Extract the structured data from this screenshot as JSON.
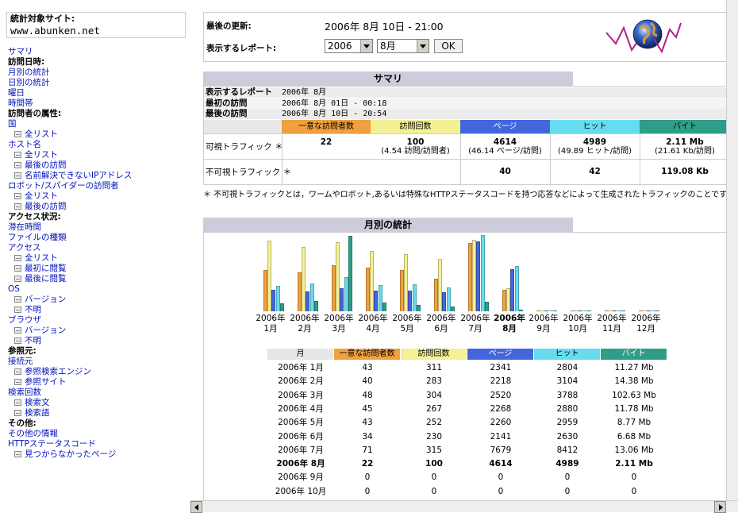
{
  "colors": {
    "unique": "#f0a040",
    "visits": "#f4f094",
    "pages": "#4466dd",
    "hits": "#66ddee",
    "bytes": "#2e9e88",
    "link": "#0011bb",
    "header_bg": "#ccccdd"
  },
  "sidebar": {
    "site_label": "統計対象サイト:",
    "site_value": "www.abunken.net",
    "menu": [
      {
        "t": "サマリ",
        "k": "link"
      },
      {
        "t": "訪問日時:",
        "k": "head"
      },
      {
        "t": "月別の統計",
        "k": "link"
      },
      {
        "t": "日別の統計",
        "k": "link"
      },
      {
        "t": "曜日",
        "k": "link"
      },
      {
        "t": "時間帯",
        "k": "link"
      },
      {
        "t": "訪問者の属性:",
        "k": "head"
      },
      {
        "t": "国",
        "k": "link"
      },
      {
        "t": "全リスト",
        "k": "sub"
      },
      {
        "t": "ホスト名",
        "k": "link"
      },
      {
        "t": "全リスト",
        "k": "sub"
      },
      {
        "t": "最後の訪問",
        "k": "sub"
      },
      {
        "t": "名前解決できないIPアドレス",
        "k": "sub"
      },
      {
        "t": "ロボット/スパイダーの訪問者",
        "k": "link"
      },
      {
        "t": "全リスト",
        "k": "sub"
      },
      {
        "t": "最後の訪問",
        "k": "sub"
      },
      {
        "t": "アクセス状況:",
        "k": "head"
      },
      {
        "t": "滞在時間",
        "k": "link"
      },
      {
        "t": "ファイルの種類",
        "k": "link"
      },
      {
        "t": "アクセス",
        "k": "link"
      },
      {
        "t": "全リスト",
        "k": "sub"
      },
      {
        "t": "最初に閲覧",
        "k": "sub"
      },
      {
        "t": "最後に閲覧",
        "k": "sub"
      },
      {
        "t": "OS",
        "k": "link"
      },
      {
        "t": "バージョン",
        "k": "sub"
      },
      {
        "t": "不明",
        "k": "sub"
      },
      {
        "t": "ブラウザ",
        "k": "link"
      },
      {
        "t": "バージョン",
        "k": "sub"
      },
      {
        "t": "不明",
        "k": "sub"
      },
      {
        "t": "参照元:",
        "k": "head"
      },
      {
        "t": "接続元",
        "k": "link"
      },
      {
        "t": "参照検索エンジン",
        "k": "sub"
      },
      {
        "t": "参照サイト",
        "k": "sub"
      },
      {
        "t": "検索回数",
        "k": "link"
      },
      {
        "t": "検索文",
        "k": "sub"
      },
      {
        "t": "検索語",
        "k": "sub"
      },
      {
        "t": "その他:",
        "k": "head"
      },
      {
        "t": "その他の情報",
        "k": "link"
      },
      {
        "t": "HTTPステータスコード",
        "k": "link"
      },
      {
        "t": "見つからなかったページ",
        "k": "sub"
      }
    ]
  },
  "header": {
    "last_update_label": "最後の更新:",
    "last_update_value": "2006年 8月 10日 - 21:00",
    "report_label": "表示するレポート:",
    "year_select": "2006",
    "month_select": "8月",
    "ok_label": "OK"
  },
  "summary": {
    "title": "サマリ",
    "rows": [
      {
        "k": "表示するレポート",
        "v": "2006年 8月"
      },
      {
        "k": "最初の訪問",
        "v": "2006年 8月 01日 - 00:18"
      },
      {
        "k": "最後の訪問",
        "v": "2006年 8月 10日 - 20:54"
      }
    ],
    "cols": [
      "一意な訪問者数",
      "訪問回数",
      "ページ",
      "ヒット",
      "バイト"
    ],
    "visible_label": "可視トラフィック ＊",
    "visible": [
      {
        "a": "22",
        "b": ""
      },
      {
        "a": "100",
        "b": "(4.54 訪問/訪問者)"
      },
      {
        "a": "4614",
        "b": "(46.14 ページ/訪問)"
      },
      {
        "a": "4989",
        "b": "(49.89 ヒット/訪問)"
      },
      {
        "a": "2.11 Mb",
        "b": "(21.61 Kb/訪問)"
      }
    ],
    "invisible_label": "不可視トラフィック ＊",
    "invisible": [
      "",
      "",
      "40",
      "42",
      "119.08 Kb"
    ],
    "note": "＊ 不可視トラフィックとは，ワームやロボット,あるいは特殊なHTTPステータスコードを持つ応答などによって生成されたトラフィックのことです."
  },
  "monthly": {
    "title": "月別の統計",
    "table_headers": [
      "月",
      "一意な訪問者数",
      "訪問回数",
      "ページ",
      "ヒット",
      "バイト"
    ],
    "rows": [
      {
        "m": "2006年 1月",
        "u": "43",
        "v": "311",
        "p": "2341",
        "h": "2804",
        "b": "11.27 Mb"
      },
      {
        "m": "2006年 2月",
        "u": "40",
        "v": "283",
        "p": "2218",
        "h": "3104",
        "b": "14.38 Mb"
      },
      {
        "m": "2006年 3月",
        "u": "48",
        "v": "304",
        "p": "2520",
        "h": "3788",
        "b": "102.63 Mb"
      },
      {
        "m": "2006年 4月",
        "u": "45",
        "v": "267",
        "p": "2268",
        "h": "2880",
        "b": "11.78 Mb"
      },
      {
        "m": "2006年 5月",
        "u": "43",
        "v": "252",
        "p": "2260",
        "h": "2959",
        "b": "8.77 Mb"
      },
      {
        "m": "2006年 6月",
        "u": "34",
        "v": "230",
        "p": "2141",
        "h": "2630",
        "b": "6.68 Mb"
      },
      {
        "m": "2006年 7月",
        "u": "71",
        "v": "315",
        "p": "7679",
        "h": "8412",
        "b": "13.06 Mb"
      },
      {
        "m": "2006年 8月",
        "u": "22",
        "v": "100",
        "p": "4614",
        "h": "4989",
        "b": "2.11 Mb",
        "bold": true
      },
      {
        "m": "2006年 9月",
        "u": "0",
        "v": "0",
        "p": "0",
        "h": "0",
        "b": "0"
      },
      {
        "m": "2006年 10月",
        "u": "0",
        "v": "0",
        "p": "0",
        "h": "0",
        "b": "0"
      }
    ]
  },
  "chart_data": {
    "type": "bar",
    "categories": [
      "2006年 1月",
      "2006年 2月",
      "2006年 3月",
      "2006年 4月",
      "2006年 5月",
      "2006年 6月",
      "2006年 7月",
      "2006年 8月",
      "2006年 9月",
      "2006年 10月",
      "2006年 11月",
      "2006年 12月"
    ],
    "x_year": [
      "2006年",
      "2006年",
      "2006年",
      "2006年",
      "2006年",
      "2006年",
      "2006年",
      "2006年",
      "2006年",
      "2006年",
      "2006年",
      "2006年"
    ],
    "x_month": [
      "1月",
      "2月",
      "3月",
      "4月",
      "5月",
      "6月",
      "7月",
      "8月",
      "9月",
      "10月",
      "11月",
      "12月"
    ],
    "series": [
      {
        "name": "一意な訪問者数",
        "values": [
          43,
          40,
          48,
          45,
          43,
          34,
          71,
          22,
          0,
          0,
          0,
          0
        ]
      },
      {
        "name": "訪問回数",
        "values": [
          311,
          283,
          304,
          267,
          252,
          230,
          315,
          100,
          0,
          0,
          0,
          0
        ]
      },
      {
        "name": "ページ",
        "values": [
          2341,
          2218,
          2520,
          2268,
          2260,
          2141,
          7679,
          4614,
          0,
          0,
          0,
          0
        ]
      },
      {
        "name": "ヒット",
        "values": [
          2804,
          3104,
          3788,
          2880,
          2959,
          2630,
          8412,
          4989,
          0,
          0,
          0,
          0
        ]
      },
      {
        "name": "バイト",
        "values": [
          11.27,
          14.38,
          102.63,
          11.78,
          8.77,
          6.68,
          13.06,
          2.11,
          0,
          0,
          0,
          0
        ]
      }
    ],
    "highlight_index": 7
  }
}
